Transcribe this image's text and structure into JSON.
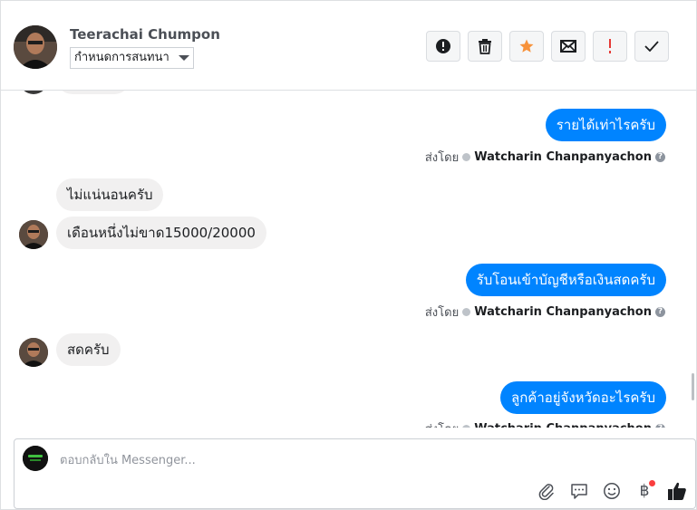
{
  "contact": {
    "name": "Teerachai Chumpon",
    "assign_label": "กำหนดการสนทนา"
  },
  "header_actions": [
    {
      "icon": "alert-circle-icon"
    },
    {
      "icon": "trash-icon"
    },
    {
      "icon": "star-icon",
      "color": "#f7923b"
    },
    {
      "icon": "envelope-icon"
    },
    {
      "icon": "exclamation-icon",
      "color": "#e53935"
    },
    {
      "icon": "checkmark-icon"
    }
  ],
  "messages": [
    {
      "direction": "out",
      "text": "รายได้เท่าไรครับ"
    },
    {
      "direction": "in",
      "text": "ไม่แน่นอนครับ"
    },
    {
      "direction": "in",
      "text": "เดือนหนึ่งไม่ขาด15000/20000"
    },
    {
      "direction": "out",
      "text": "รับโอนเข้าบัญชีหรือเงินสดครับ"
    },
    {
      "direction": "in",
      "text": "สดครับ"
    },
    {
      "direction": "out",
      "text": "ลูกค้าอยู่จังหวัดอะไรครับ"
    }
  ],
  "sent_by": {
    "prefix": "ส่งโดย",
    "agent": "Watcharin Chanpanyachon"
  },
  "composer": {
    "placeholder": "ตอบกลับใน Messenger...",
    "tools": [
      "paperclip-icon",
      "quick-reply-icon",
      "emoji-icon",
      "baht-payment-icon",
      "thumbs-up-icon"
    ],
    "baht_symbol": "฿"
  },
  "colors": {
    "outgoing_bubble": "#0084ff",
    "incoming_bubble": "#f1f0f0",
    "star": "#f7923b",
    "alert": "#e53935"
  }
}
